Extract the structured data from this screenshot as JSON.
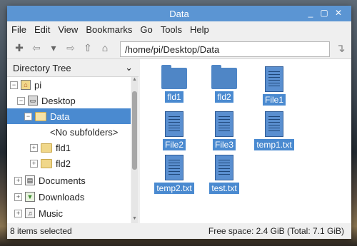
{
  "window": {
    "title": "Data"
  },
  "menu": [
    "File",
    "Edit",
    "View",
    "Bookmarks",
    "Go",
    "Tools",
    "Help"
  ],
  "toolbar": {
    "path": "/home/pi/Desktop/Data"
  },
  "sidepanel": {
    "header": "Directory Tree",
    "tree": [
      {
        "label": "pi",
        "expander": "⊟",
        "icon": "home-icon"
      },
      {
        "label": "Desktop",
        "expander": "⊟",
        "icon": "desktop-icon"
      },
      {
        "label": "Data",
        "expander": "⊟",
        "icon": "folder-icon",
        "selected": true
      },
      {
        "label": "<No subfolders>"
      },
      {
        "label": "fld1",
        "expander": "⊞",
        "icon": "folder-icon"
      },
      {
        "label": "fld2",
        "expander": "⊞",
        "icon": "folder-icon"
      },
      {
        "label": "Documents",
        "expander": "⊞",
        "icon": "documents-icon"
      },
      {
        "label": "Downloads",
        "expander": "⊞",
        "icon": "downloads-icon"
      },
      {
        "label": "Music",
        "expander": "⊞",
        "icon": "music-icon"
      }
    ]
  },
  "files": [
    {
      "name": "fld1",
      "type": "folder"
    },
    {
      "name": "fld2",
      "type": "folder"
    },
    {
      "name": "File1",
      "type": "file"
    },
    {
      "name": "File2",
      "type": "file"
    },
    {
      "name": "File3",
      "type": "file"
    },
    {
      "name": "temp1.txt",
      "type": "file"
    },
    {
      "name": "temp2.txt",
      "type": "file"
    },
    {
      "name": "test.txt",
      "type": "file"
    }
  ],
  "status": {
    "left": "8 items selected",
    "right": "Free space: 2.4 GiB (Total: 7.1 GiB)"
  }
}
